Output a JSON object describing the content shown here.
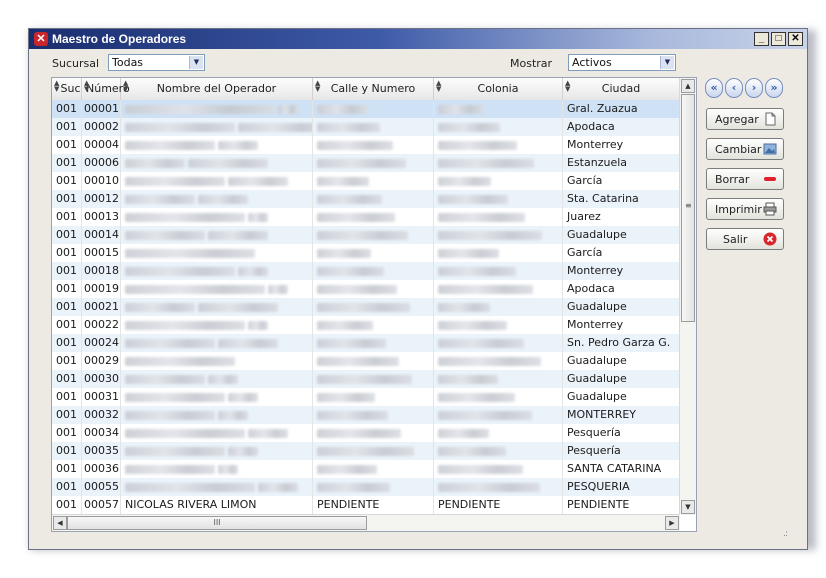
{
  "window": {
    "title": "Maestro de Operadores"
  },
  "filters": {
    "sucursal_label": "Sucursal",
    "sucursal_value": "Todas",
    "mostrar_label": "Mostrar",
    "mostrar_value": "Activos"
  },
  "grid": {
    "columns": [
      "Suc",
      "Número",
      "Nombre del Operador",
      "Calle y Numero",
      "Colonia",
      "Ciudad"
    ],
    "rows": [
      {
        "suc": "001",
        "num": "00001",
        "nombre": "",
        "calle": "",
        "colonia": "",
        "ciudad": "Gral. Zuazua"
      },
      {
        "suc": "001",
        "num": "00002",
        "nombre": "",
        "calle": "",
        "colonia": "",
        "ciudad": "Apodaca"
      },
      {
        "suc": "001",
        "num": "00004",
        "nombre": "",
        "calle": "",
        "colonia": "",
        "ciudad": "Monterrey"
      },
      {
        "suc": "001",
        "num": "00006",
        "nombre": "",
        "calle": "",
        "colonia": "",
        "ciudad": "Estanzuela"
      },
      {
        "suc": "001",
        "num": "00010",
        "nombre": "",
        "calle": "",
        "colonia": "",
        "ciudad": "García"
      },
      {
        "suc": "001",
        "num": "00012",
        "nombre": "",
        "calle": "",
        "colonia": "",
        "ciudad": "Sta. Catarina"
      },
      {
        "suc": "001",
        "num": "00013",
        "nombre": "",
        "calle": "",
        "colonia": "",
        "ciudad": "Juarez"
      },
      {
        "suc": "001",
        "num": "00014",
        "nombre": "",
        "calle": "",
        "colonia": "",
        "ciudad": "Guadalupe"
      },
      {
        "suc": "001",
        "num": "00015",
        "nombre": "",
        "calle": "",
        "colonia": "",
        "ciudad": "García"
      },
      {
        "suc": "001",
        "num": "00018",
        "nombre": "",
        "calle": "",
        "colonia": "",
        "ciudad": "Monterrey"
      },
      {
        "suc": "001",
        "num": "00019",
        "nombre": "",
        "calle": "",
        "colonia": "",
        "ciudad": "Apodaca"
      },
      {
        "suc": "001",
        "num": "00021",
        "nombre": "",
        "calle": "",
        "colonia": "",
        "ciudad": "Guadalupe"
      },
      {
        "suc": "001",
        "num": "00022",
        "nombre": "",
        "calle": "",
        "colonia": "",
        "ciudad": "Monterrey"
      },
      {
        "suc": "001",
        "num": "00024",
        "nombre": "",
        "calle": "",
        "colonia": "",
        "ciudad": "Sn. Pedro Garza G."
      },
      {
        "suc": "001",
        "num": "00029",
        "nombre": "",
        "calle": "",
        "colonia": "",
        "ciudad": "Guadalupe"
      },
      {
        "suc": "001",
        "num": "00030",
        "nombre": "",
        "calle": "",
        "colonia": "",
        "ciudad": "Guadalupe"
      },
      {
        "suc": "001",
        "num": "00031",
        "nombre": "",
        "calle": "",
        "colonia": "",
        "ciudad": "Guadalupe"
      },
      {
        "suc": "001",
        "num": "00032",
        "nombre": "",
        "calle": "",
        "colonia": "",
        "ciudad": "MONTERREY"
      },
      {
        "suc": "001",
        "num": "00034",
        "nombre": "",
        "calle": "",
        "colonia": "",
        "ciudad": "Pesquería"
      },
      {
        "suc": "001",
        "num": "00035",
        "nombre": "",
        "calle": "",
        "colonia": "",
        "ciudad": "Pesquería"
      },
      {
        "suc": "001",
        "num": "00036",
        "nombre": "",
        "calle": "",
        "colonia": "",
        "ciudad": "SANTA CATARINA"
      },
      {
        "suc": "001",
        "num": "00055",
        "nombre": "",
        "calle": "",
        "colonia": "",
        "ciudad": "PESQUERIA"
      },
      {
        "suc": "001",
        "num": "00057",
        "nombre": "NICOLAS RIVERA LIMON",
        "calle": "PENDIENTE",
        "colonia": "PENDIENTE",
        "ciudad": "PENDIENTE"
      }
    ]
  },
  "actions": {
    "agregar": "Agregar",
    "cambiar": "Cambiar",
    "borrar": "Borrar",
    "imprimir": "Imprimir",
    "salir": "Salir"
  },
  "icons": {
    "nav": [
      "first-icon",
      "prev-icon",
      "next-icon",
      "last-icon"
    ]
  },
  "colors": {
    "titlebar": "#1a2d6e",
    "selected_row": "#cfe1f4",
    "alt_row": "#eaf2fa",
    "exit_icon": "#d9262c",
    "delete_icon": "#e0212f"
  }
}
